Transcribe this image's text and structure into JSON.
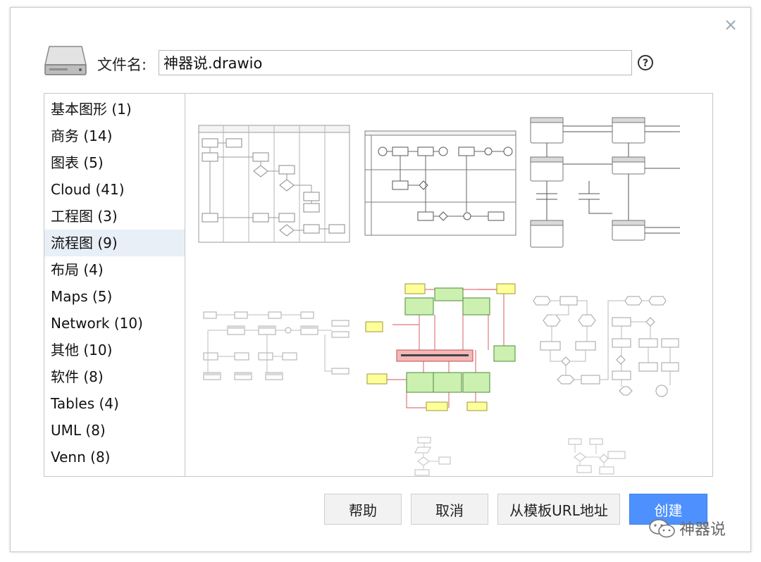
{
  "dialog": {
    "close_glyph": "×",
    "filename_label": "文件名:",
    "filename_value": "神器说.drawio",
    "help_glyph": "?"
  },
  "categories": [
    {
      "label": "基本图形 (1)"
    },
    {
      "label": "商务 (14)"
    },
    {
      "label": "图表 (5)"
    },
    {
      "label": "Cloud (41)"
    },
    {
      "label": "工程图 (3)"
    },
    {
      "label": "流程图 (9)",
      "selected": true
    },
    {
      "label": "布局 (4)"
    },
    {
      "label": "Maps (5)"
    },
    {
      "label": "Network (10)"
    },
    {
      "label": "其他 (10)"
    },
    {
      "label": "软件 (8)"
    },
    {
      "label": "Tables (4)"
    },
    {
      "label": "UML (8)"
    },
    {
      "label": "Venn (8)"
    }
  ],
  "buttons": {
    "help": "帮助",
    "cancel": "取消",
    "from_url": "从模板URL地址",
    "create": "创建"
  },
  "watermark": "神器说",
  "colors": {
    "accent": "#4d90fe",
    "selected_bg": "#e8eff7",
    "node_green": "#ccf0b0",
    "node_yellow": "#ffff99",
    "node_red": "#f4b7b7"
  },
  "icons": [
    "disk-icon",
    "help-icon",
    "close-icon",
    "wechat-icon"
  ]
}
